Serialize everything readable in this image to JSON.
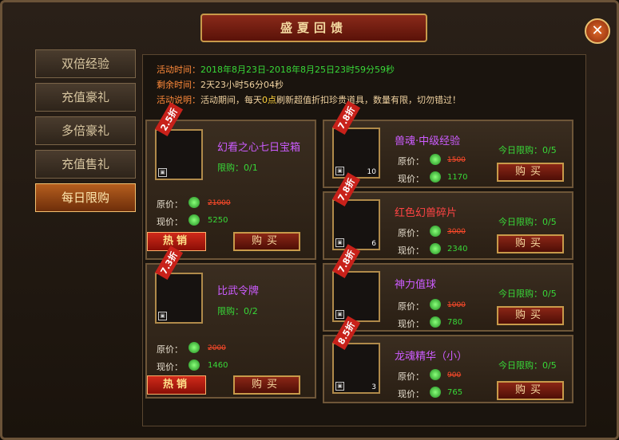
{
  "window": {
    "title": "盛夏回馈",
    "close_symbol": "✕"
  },
  "sidebar": {
    "tabs": [
      {
        "label": "双倍经验"
      },
      {
        "label": "充值豪礼"
      },
      {
        "label": "多倍豪礼"
      },
      {
        "label": "充值售礼"
      },
      {
        "label": "每日限购",
        "active": true
      }
    ]
  },
  "event": {
    "time_label": "活动时间：",
    "time_value": "2018年8月23日-2018年8月25日23时59分59秒",
    "remaining_label": "剩余时间：",
    "remaining_value": "2天23小时56分04秒",
    "desc_label": "活动说明：",
    "desc_prefix": "活动期间，每天",
    "desc_highlight": "0点",
    "desc_suffix": "刷新超值折扣珍贵道具，数量有限，切勿错过！"
  },
  "labels": {
    "original": "原价：",
    "current": "现价：",
    "buy": "购买",
    "hot": "热销"
  },
  "items": [
    {
      "discount": "2.5折",
      "name": "幻看之心七日宝箱",
      "limit": "限购：0/1",
      "original": "21000",
      "current": "5250",
      "hot": true,
      "icon": "treasure-chest-icon"
    },
    {
      "discount": "7.3折",
      "name": "比武令牌",
      "limit": "限购：0/2",
      "original": "2000",
      "current": "1460",
      "hot": true,
      "icon": "token-icon"
    },
    {
      "discount": "7.8折",
      "name": "兽魂·中级经验",
      "daily": "今日限购：0/5",
      "original": "1500",
      "current": "1170",
      "qty": "10",
      "icon": "exp-orb-icon"
    },
    {
      "discount": "7.8折",
      "name": "红色幻兽碎片",
      "daily": "今日限购：0/5",
      "original": "3000",
      "current": "2340",
      "qty": "6",
      "icon": "lotus-shard-icon"
    },
    {
      "discount": "7.8折",
      "name": "神力值球",
      "daily": "今日限购：0/5",
      "original": "1000",
      "current": "780",
      "qty": "",
      "icon": "power-orb-icon"
    },
    {
      "discount": "8.5折",
      "name": "龙魂精华（小）",
      "daily": "今日限购：0/5",
      "original": "900",
      "current": "765",
      "qty": "3",
      "icon": "dragon-essence-icon"
    }
  ],
  "colors": {
    "accent": "#b55e1e",
    "discount": "#c8211a",
    "price": "#38d838",
    "item_name": "#cc5cff"
  }
}
